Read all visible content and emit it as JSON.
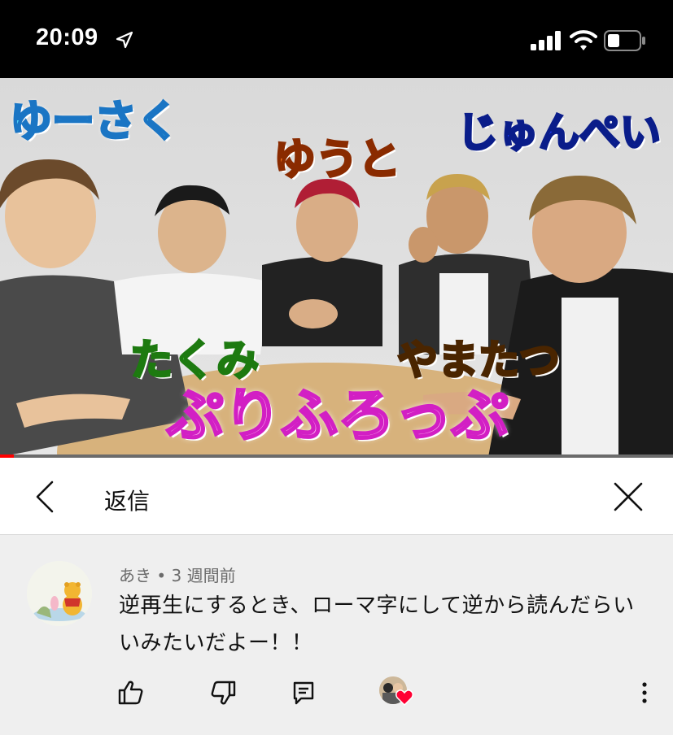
{
  "status_bar": {
    "time": "20:09",
    "icons": [
      "location-arrow-icon",
      "cellular-signal-icon",
      "wifi-icon",
      "battery-icon"
    ]
  },
  "video": {
    "captions": {
      "yusaku": "ゆーさく",
      "yuto": "ゆうと",
      "junpei": "じゅんぺい",
      "takumi": "たくみ",
      "yamatatsu": "やまたつ",
      "title": "ぷりふろっぷ"
    },
    "progress": 0.02,
    "progress_color": "#ff0000"
  },
  "reply_panel": {
    "title": "返信",
    "back_icon": "chevron-left-icon",
    "close_icon": "close-icon"
  },
  "comment": {
    "author": "あき",
    "separator": "•",
    "age": "3 週間前",
    "text": "逆再生にするとき、ローマ字にして逆から読んだらいいみたいだよー！！",
    "actions": [
      "thumbs-up-icon",
      "thumbs-down-icon",
      "reply-icon",
      "creator-heart-icon",
      "more-vert-icon"
    ],
    "heart_color": "#ff0033"
  }
}
